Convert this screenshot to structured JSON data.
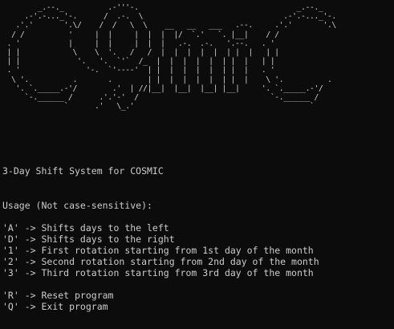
{
  "console": {
    "background": "#0c0c0c",
    "foreground": "#cccccc",
    "ascii_banner": "        _.--._          .-'''-.                                    _.--._\n     .-'.-..._'-.      /  .-.  \\                                .-'.-..._'-.\n   .'.'       '.\\/    /  /   \\  \\    __   __   ___   .--.     .'.'       '.\\\n  / /          '     |  |     |  |  |  |/  `.'   `. |__|    / /\n . '           |     |  |     |  |  |   .-.  .-.   '.--.   . '\n | |            \\    \\  '.   /   /  |  |  |  |  |  | |  |   | |\n | |             '.   '.  `'`  /_  |  |  |  |  |  | |  |   | |\n . '               '-.  `'----'  | |  |  |  |  |  | |  |   . '\n  \\ '.          .       .        | |  |  |  |  |  | |  |    \\ '.          .\n   '. `._____.-'/        .'  | //|__|  |__|  |__| |__|     '. `._____.-'/\n     `-.______ /      .'.'-'  /                              `-.______ /\n              `      .'   \\_.'                                        `",
    "lines": [
      "3-Day Shift System for COSMIC",
      "Usage (Not case-sensitive):",
      "'A' -> Shifts days to the left",
      "'D' -> Shifts days to the right",
      "'1' -> First rotation starting from 1st day of the month",
      "'2' -> Second rotation starting from 2nd day of the month",
      "'3' -> Third rotation starting from 3rd day of the month",
      "'R' -> Reset program",
      "'Q' -> Exit program"
    ]
  }
}
